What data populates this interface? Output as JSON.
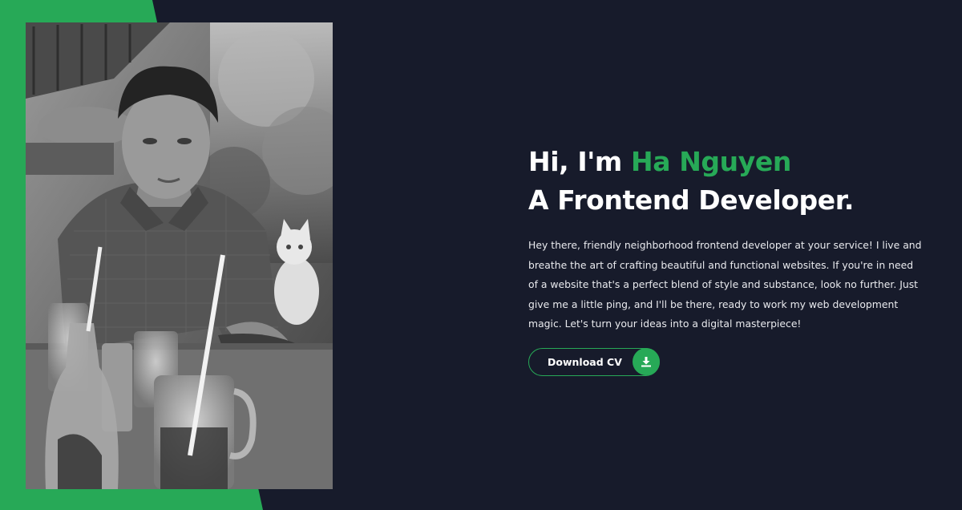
{
  "hero": {
    "greeting": "Hi, I'm ",
    "name": "Ha Nguyen",
    "role": "A Frontend Developer.",
    "description": "Hey there, friendly neighborhood frontend developer at your service! I live and breathe the art of crafting beautiful and functional websites. If you're in need of a website that's a perfect blend of style and substance, look no further. Just give me a little ping, and I'll be there, ready to work my web development magic. Let's turn your ideas into a digital masterpiece!",
    "cv_button_label": "Download CV",
    "cv_button_icon": "download-icon"
  },
  "colors": {
    "background": "#171b2b",
    "accent": "#27a957",
    "text": "#ffffff"
  }
}
